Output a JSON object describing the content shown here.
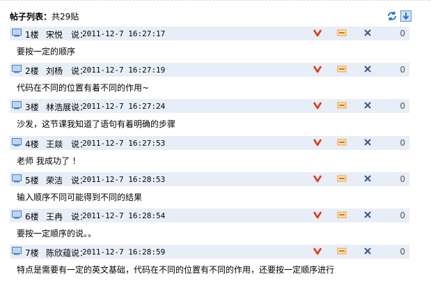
{
  "header": {
    "title": "帖子列表：",
    "count": "共29贴"
  },
  "says": "说：",
  "posts": [
    {
      "floor": "1楼",
      "author": "宋悦",
      "time": "2011-12-7 16:27:17",
      "content": "要按一定的顺序",
      "replies": "0"
    },
    {
      "floor": "2楼",
      "author": "刘杨",
      "time": "2011-12-7 16:27:19",
      "content": "代码在不同的位置有着不同的作用~",
      "replies": "0"
    },
    {
      "floor": "3楼",
      "author": "林浩展",
      "time": "2011-12-7 16:27:24",
      "content": "沙发，这节课我知道了语句有着明确的步骤",
      "replies": "0"
    },
    {
      "floor": "4楼",
      "author": "王燚",
      "time": "2011-12-7 16:27:53",
      "content": "老师 我成功了 ！",
      "replies": "0"
    },
    {
      "floor": "5楼",
      "author": "荣洁",
      "time": "2011-12-7 16:28:53",
      "content": "输入顺序不同可能得到不同的结果",
      "replies": "0"
    },
    {
      "floor": "6楼",
      "author": "王冉",
      "time": "2011-12-7 16:28:54",
      "content": "要按一定顺序的说。。",
      "replies": "0"
    },
    {
      "floor": "7楼",
      "author": "陈欣蕴",
      "time": "2011-12-7 16:28:59",
      "content": "特点是需要有一定的英文基础，代码在不同的位置有不同的作用，还要按一定顺序进行",
      "replies": "0"
    }
  ],
  "colors": {
    "bar": "#e8eef7",
    "vote": "#e03a1a",
    "minus": "#f0a020",
    "close": "#3a5a90"
  }
}
